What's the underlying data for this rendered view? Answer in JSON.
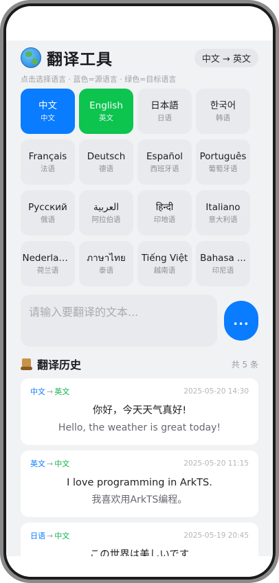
{
  "header": {
    "title": "翻译工具",
    "lang_pair": "中文 → 英文",
    "hint": "点击选择语言 · 蓝色=源语言 · 绿色=目标语言"
  },
  "languages": [
    {
      "native": "中文",
      "cn": "中文",
      "state": "source"
    },
    {
      "native": "English",
      "cn": "英文",
      "state": "target"
    },
    {
      "native": "日本語",
      "cn": "日语",
      "state": "none"
    },
    {
      "native": "한국어",
      "cn": "韩语",
      "state": "none"
    },
    {
      "native": "Français",
      "cn": "法语",
      "state": "none"
    },
    {
      "native": "Deutsch",
      "cn": "德语",
      "state": "none"
    },
    {
      "native": "Español",
      "cn": "西班牙语",
      "state": "none"
    },
    {
      "native": "Português",
      "cn": "葡萄牙语",
      "state": "none"
    },
    {
      "native": "Русский",
      "cn": "俄语",
      "state": "none"
    },
    {
      "native": "العربية",
      "cn": "阿拉伯语",
      "state": "none"
    },
    {
      "native": "हिन्दी",
      "cn": "印地语",
      "state": "none"
    },
    {
      "native": "Italiano",
      "cn": "意大利语",
      "state": "none"
    },
    {
      "native": "Nederlands",
      "cn": "荷兰语",
      "state": "none"
    },
    {
      "native": "ภาษาไทย",
      "cn": "泰语",
      "state": "none"
    },
    {
      "native": "Tiếng Việt",
      "cn": "越南语",
      "state": "none"
    },
    {
      "native": "Bahasa ...",
      "cn": "印尼语",
      "state": "none"
    }
  ],
  "input": {
    "placeholder": "请输入要翻译的文本...",
    "value": ""
  },
  "translate_button": {
    "label": "..."
  },
  "history": {
    "title": "翻译历史",
    "count": "共 5 条",
    "items": [
      {
        "src": "中文",
        "arrow": "→",
        "tgt": "英文",
        "time": "2025-05-20 14:30",
        "original": "你好，今天天气真好!",
        "translation": "Hello, the weather is great today!"
      },
      {
        "src": "英文",
        "arrow": "→",
        "tgt": "中文",
        "time": "2025-05-20 11:15",
        "original": "I love programming in ArkTS.",
        "translation": "我喜欢用ArkTS编程。"
      },
      {
        "src": "日语",
        "arrow": "→",
        "tgt": "中文",
        "time": "2025-05-19 20:45",
        "original": "この世界は美しいです",
        "translation": ""
      }
    ]
  },
  "colors": {
    "source": "#0a7cff",
    "target": "#0cc44e",
    "background": "#f1f2f4"
  },
  "icons": {
    "title_icon": "globe-icon",
    "history_icon": "scroll-icon"
  }
}
